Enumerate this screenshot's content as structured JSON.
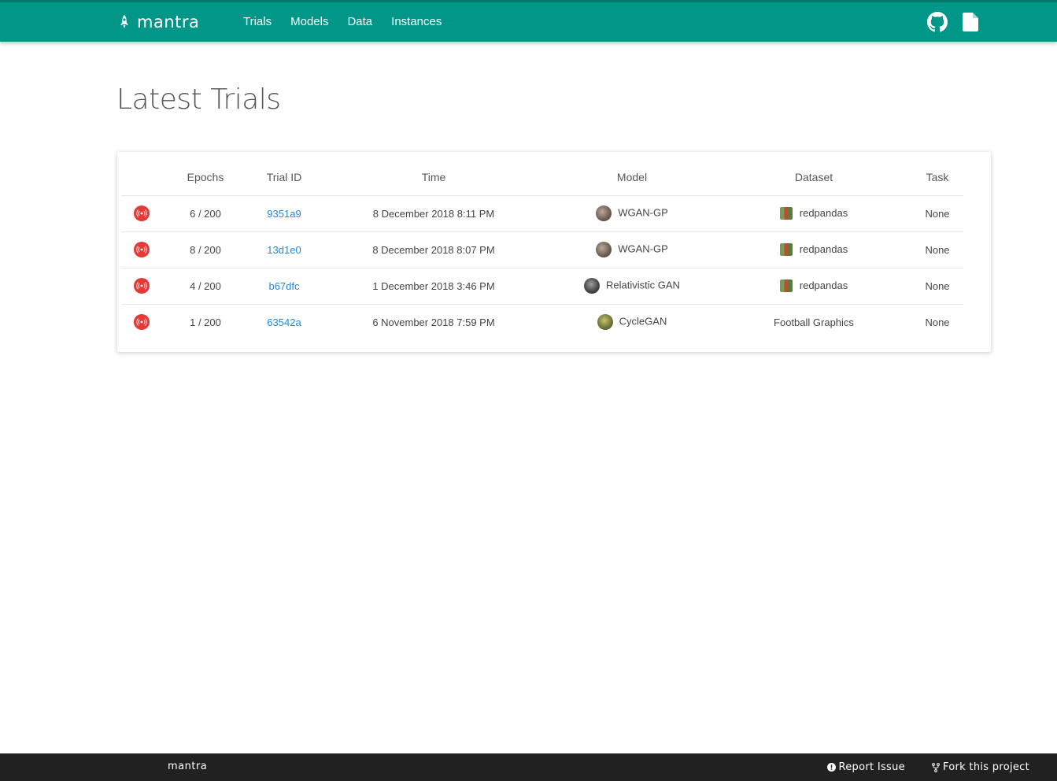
{
  "brand": {
    "name": "mantra",
    "logo_icon": "rocket-icon"
  },
  "nav": {
    "items": [
      {
        "label": "Trials"
      },
      {
        "label": "Models"
      },
      {
        "label": "Data"
      },
      {
        "label": "Instances"
      }
    ]
  },
  "nav_right": {
    "github_icon": "github-icon",
    "docs_icon": "document-icon"
  },
  "page": {
    "title": "Latest Trials"
  },
  "table": {
    "headers": [
      "",
      "Epochs",
      "Trial ID",
      "Time",
      "Model",
      "Dataset",
      "Task"
    ],
    "rows": [
      {
        "status_icon": "live-broadcast-icon",
        "epochs": "6 / 200",
        "trial_id": "9351a9",
        "time": "8 December 2018 8:11 PM",
        "model": "WGAN-GP",
        "dataset": "redpandas",
        "task": "None"
      },
      {
        "status_icon": "live-broadcast-icon",
        "epochs": "8 / 200",
        "trial_id": "13d1e0",
        "time": "8 December 2018 8:07 PM",
        "model": "WGAN-GP",
        "dataset": "redpandas",
        "task": "None"
      },
      {
        "status_icon": "live-broadcast-icon",
        "epochs": "4 / 200",
        "trial_id": "b67dfc",
        "time": "1 December 2018 3:46 PM",
        "model": "Relativistic GAN",
        "dataset": "redpandas",
        "task": "None"
      },
      {
        "status_icon": "live-broadcast-icon",
        "epochs": "1 / 200",
        "trial_id": "63542a",
        "time": "6 November 2018 7:59 PM",
        "model": "CycleGAN",
        "dataset": "Football Graphics",
        "task": "None"
      }
    ]
  },
  "footer": {
    "brand": "mantra",
    "report_issue": "Report Issue",
    "fork_project": "Fork this project"
  },
  "colors": {
    "primary": "#009688",
    "status_live": "#e53935",
    "link": "#1e88e5",
    "footer_bg": "#212121"
  }
}
